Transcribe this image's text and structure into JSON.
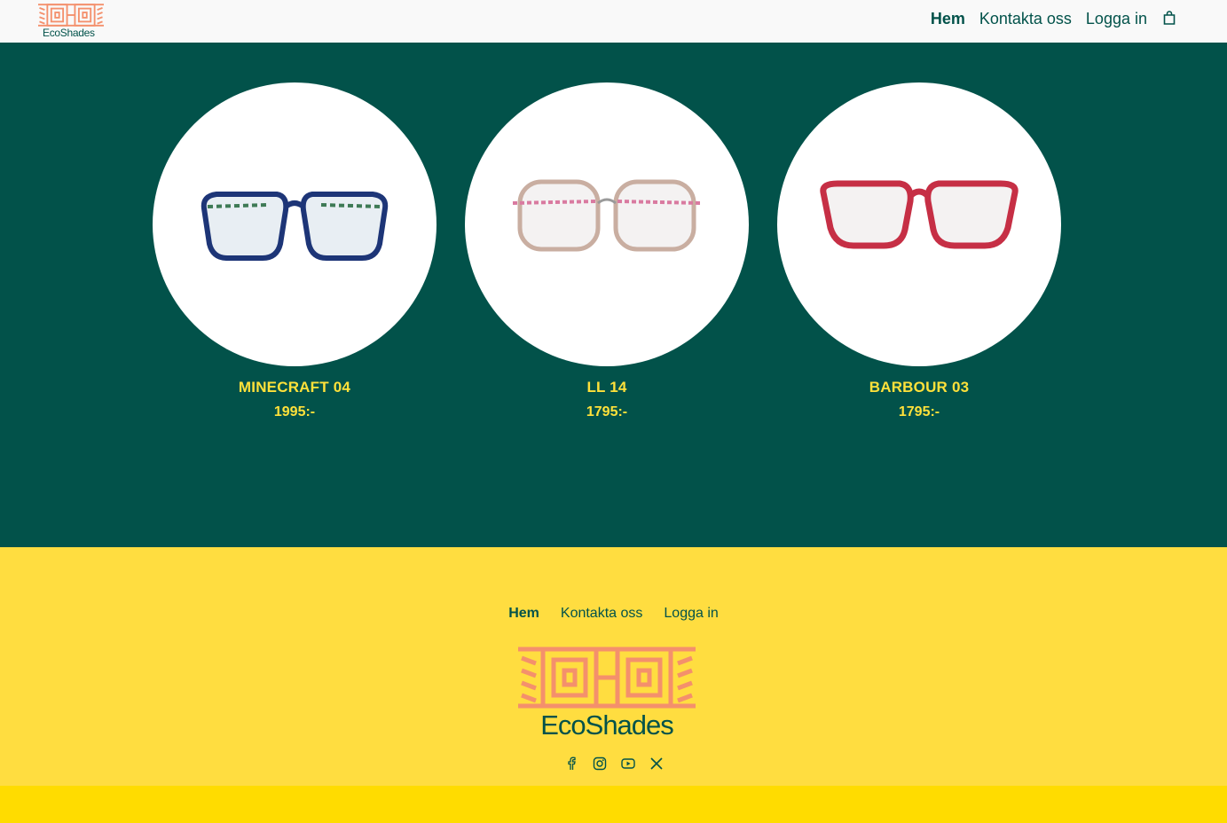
{
  "brand": {
    "name": "EcoShades"
  },
  "colors": {
    "primary": "#02524a",
    "accent": "#ffe13a",
    "footer": "#ffdd40",
    "logo": "#f4906c"
  },
  "header": {
    "nav": [
      {
        "label": "Hem",
        "active": true
      },
      {
        "label": "Kontakta oss",
        "active": false
      },
      {
        "label": "Logga in",
        "active": false
      }
    ],
    "cart_icon": "shopping-bag-icon"
  },
  "products": [
    {
      "name": "MINECRAFT 04",
      "price": "1995:-",
      "frame_color": "#1d3577"
    },
    {
      "name": "LL 14",
      "price": "1795:-",
      "frame_color": "#c9aea1"
    },
    {
      "name": "BARBOUR 03",
      "price": "1795:-",
      "frame_color": "#c62f45"
    }
  ],
  "footer": {
    "nav": [
      {
        "label": "Hem",
        "active": true
      },
      {
        "label": "Kontakta oss",
        "active": false
      },
      {
        "label": "Logga in",
        "active": false
      }
    ],
    "social": [
      "facebook-icon",
      "instagram-icon",
      "youtube-icon",
      "x-icon"
    ]
  }
}
